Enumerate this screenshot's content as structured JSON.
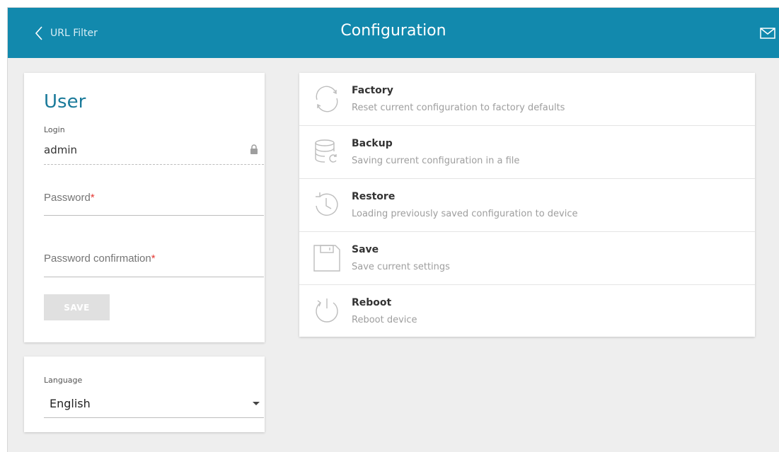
{
  "header": {
    "back_label": "URL Filter",
    "title": "Configuration",
    "mail_icon": "mail-icon",
    "back_icon": "chevron-left-icon"
  },
  "user": {
    "title": "User",
    "login_label": "Login",
    "login_value": "admin",
    "lock_icon": "lock-icon",
    "password_label": "Password",
    "password_value": "",
    "password_confirm_label": "Password confirmation",
    "password_confirm_value": "",
    "required_mark": "*",
    "save_label": "SAVE"
  },
  "language": {
    "label": "Language",
    "selected": "English"
  },
  "actions": [
    {
      "title": "Factory",
      "description": "Reset current configuration to factory defaults",
      "icon": "factory-reset-icon"
    },
    {
      "title": "Backup",
      "description": "Saving current configuration in a file",
      "icon": "database-backup-icon"
    },
    {
      "title": "Restore",
      "description": "Loading previously saved configuration to device",
      "icon": "history-restore-icon"
    },
    {
      "title": "Save",
      "description": "Save current settings",
      "icon": "floppy-save-icon"
    },
    {
      "title": "Reboot",
      "description": "Reboot device",
      "icon": "power-reboot-icon"
    }
  ],
  "colors": {
    "header_bg": "#1289ad",
    "accent_text": "#1a7a9a",
    "required": "#e53935",
    "page_bg": "#eeeeee"
  }
}
